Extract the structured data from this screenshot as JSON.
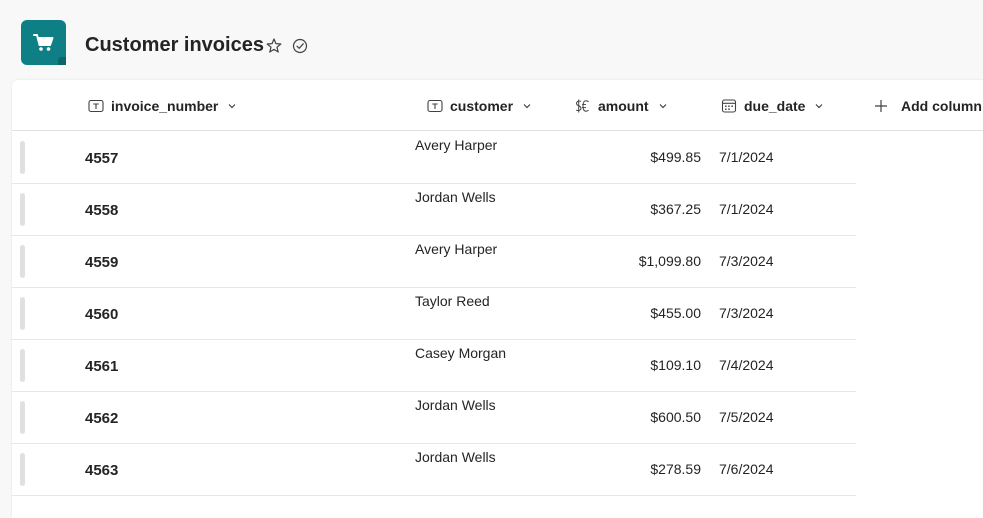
{
  "app": {
    "title": "Customer invoices",
    "icon": "shopping-cart-icon",
    "accent_color": "#0f7f86"
  },
  "columns": [
    {
      "label": "invoice_number",
      "icon": "text-type-icon"
    },
    {
      "label": "customer",
      "icon": "text-type-icon"
    },
    {
      "label": "amount",
      "icon": "currency-icon"
    },
    {
      "label": "due_date",
      "icon": "calendar-icon"
    }
  ],
  "add_column_label": "Add column",
  "rows": [
    {
      "invoice_number": "4557",
      "customer": "Avery Harper",
      "amount": "$499.85",
      "due_date": "7/1/2024"
    },
    {
      "invoice_number": "4558",
      "customer": "Jordan Wells",
      "amount": "$367.25",
      "due_date": "7/1/2024"
    },
    {
      "invoice_number": "4559",
      "customer": "Avery Harper",
      "amount": "$1,099.80",
      "due_date": "7/3/2024"
    },
    {
      "invoice_number": "4560",
      "customer": "Taylor Reed",
      "amount": "$455.00",
      "due_date": "7/3/2024"
    },
    {
      "invoice_number": "4561",
      "customer": "Casey Morgan",
      "amount": "$109.10",
      "due_date": "7/4/2024"
    },
    {
      "invoice_number": "4562",
      "customer": "Jordan Wells",
      "amount": "$600.50",
      "due_date": "7/5/2024"
    },
    {
      "invoice_number": "4563",
      "customer": "Jordan Wells",
      "amount": "$278.59",
      "due_date": "7/6/2024"
    }
  ]
}
